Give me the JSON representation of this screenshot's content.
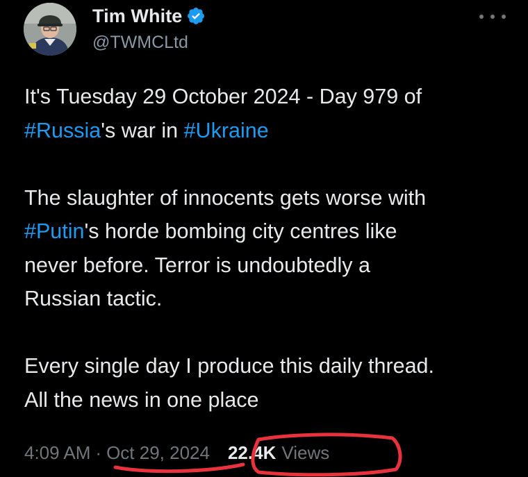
{
  "author": {
    "display_name": "Tim White",
    "handle": "@TWMCLtd",
    "verified": true,
    "verified_color": "#1d9bf0"
  },
  "menu": {
    "icon": "more-horizontal-icon"
  },
  "tweet": {
    "line1_a": "It's Tuesday 29 October 2024 - Day 979 of",
    "hashtag_russia": "#Russia",
    "line2_mid": "'s war in ",
    "hashtag_ukraine": "#Ukraine",
    "line3": "The slaughter of innocents gets worse with",
    "hashtag_putin": "#Putin",
    "line4_rest": "'s horde bombing city centres like",
    "line5": "never before. Terror is undoubtedly a",
    "line6": "Russian tactic.",
    "line7": "Every single day I produce this daily thread.",
    "line8": "All the news in one place"
  },
  "meta": {
    "time": "4:09 AM",
    "separator": "·",
    "date": "Oct 29, 2024",
    "views_count": "22.4K",
    "views_label": "Views"
  },
  "colors": {
    "background": "#000000",
    "text_primary": "#e7e9ea",
    "text_secondary": "#71767b",
    "link": "#1d9bf0",
    "annotation_red": "#e8323c"
  }
}
